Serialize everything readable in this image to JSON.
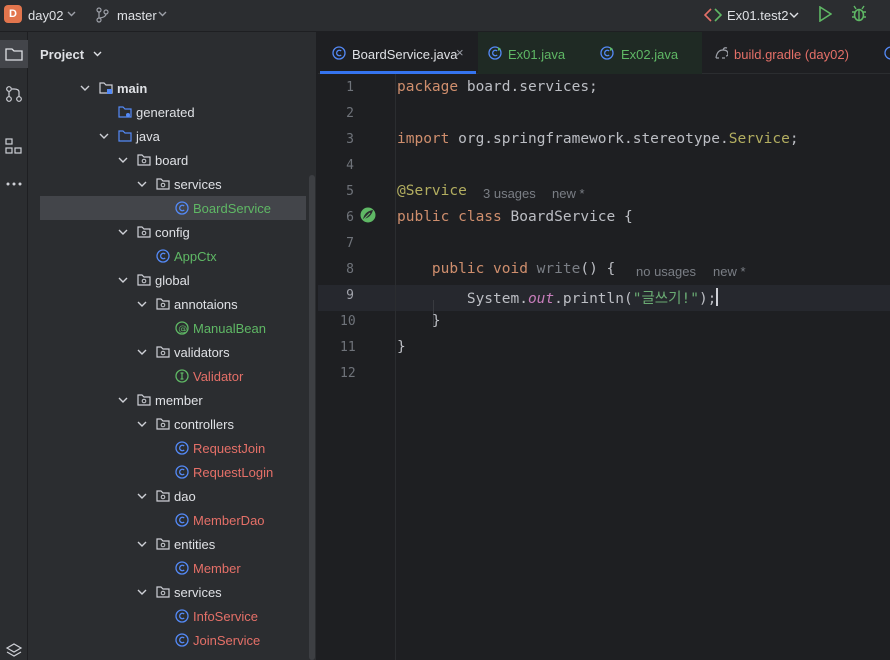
{
  "titlebar": {
    "project_initial": "D",
    "project_name": "day02",
    "branch": "master",
    "run_config": "Ex01.test2"
  },
  "project_panel": {
    "title": "Project",
    "tree": [
      {
        "label": "main",
        "kind": "module-folder",
        "expanded": true
      },
      {
        "label": "generated",
        "kind": "generated-folder"
      },
      {
        "label": "java",
        "kind": "source-folder",
        "expanded": true
      },
      {
        "label": "board",
        "kind": "package",
        "expanded": true
      },
      {
        "label": "services",
        "kind": "package",
        "expanded": true
      },
      {
        "label": "BoardService",
        "kind": "class",
        "selected": true
      },
      {
        "label": "config",
        "kind": "package",
        "expanded": true
      },
      {
        "label": "AppCtx",
        "kind": "class"
      },
      {
        "label": "global",
        "kind": "package",
        "expanded": true
      },
      {
        "label": "annotaions",
        "kind": "package",
        "expanded": true
      },
      {
        "label": "ManualBean",
        "kind": "annotation"
      },
      {
        "label": "validators",
        "kind": "package",
        "expanded": true
      },
      {
        "label": "Validator",
        "kind": "interface"
      },
      {
        "label": "member",
        "kind": "package",
        "expanded": true
      },
      {
        "label": "controllers",
        "kind": "package",
        "expanded": true
      },
      {
        "label": "RequestJoin",
        "kind": "class"
      },
      {
        "label": "RequestLogin",
        "kind": "class"
      },
      {
        "label": "dao",
        "kind": "package",
        "expanded": true
      },
      {
        "label": "MemberDao",
        "kind": "class"
      },
      {
        "label": "entities",
        "kind": "package",
        "expanded": true
      },
      {
        "label": "Member",
        "kind": "class"
      },
      {
        "label": "services",
        "kind": "package",
        "expanded": true
      },
      {
        "label": "InfoService",
        "kind": "class"
      },
      {
        "label": "JoinService",
        "kind": "class"
      }
    ]
  },
  "tabs": [
    {
      "label": "BoardService.java",
      "active": true,
      "close": "×"
    },
    {
      "label": "Ex01.java"
    },
    {
      "label": "Ex02.java"
    },
    {
      "label": "build.gradle (day02)"
    }
  ],
  "editor": {
    "line_numbers": [
      "1",
      "2",
      "3",
      "4",
      "5",
      "6",
      "7",
      "8",
      "9",
      "10",
      "11",
      "12"
    ],
    "current_line": "9",
    "code": {
      "l1_kw": "package",
      "l1_rest": " board.services;",
      "l3_kw": "import",
      "l3_pkg": " org.springframework.stereotype.",
      "l3_cls": "Service",
      "l3_end": ";",
      "l5_ann": "@Service",
      "l6_kw": "public class",
      "l6_rest": " BoardService {",
      "l8_kw": "public void",
      "l8_fn": " write",
      "l8_rest": "() {",
      "l9_a": "System.",
      "l9_out": "out",
      "l9_b": ".println(",
      "l9_str": "\"글쓰기!\"",
      "l9_c": ");",
      "l10": "}",
      "l11": "}"
    },
    "hints": {
      "l5_usages": "3 usages",
      "l5_new": "new *",
      "l8_usages": "no usages",
      "l8_new": "new *"
    }
  }
}
